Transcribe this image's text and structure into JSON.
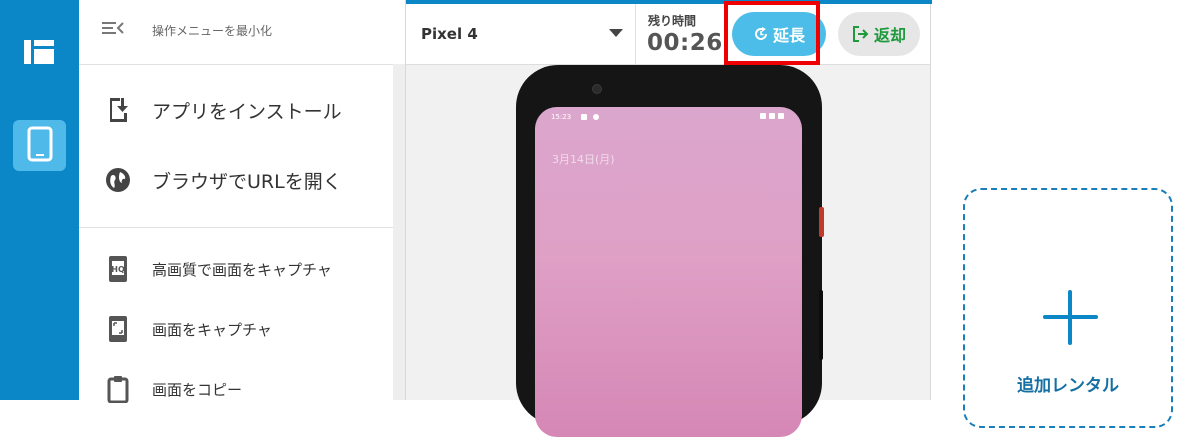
{
  "colors": {
    "rail": "#0b87c7",
    "rail_active": "#4fb9ea",
    "extend_button": "#4cbde8",
    "return_text": "#1e9a3c",
    "highlight": "#ef0000",
    "accent_blue": "#146fa3"
  },
  "rail": {
    "items": [
      {
        "icon": "panel-layout-icon",
        "active": false
      },
      {
        "icon": "smartphone-icon",
        "active": true
      }
    ]
  },
  "menu": {
    "collapse_label": "操作メニューを最小化",
    "primary_items": [
      {
        "label": "アプリをインストール",
        "icon": "install-app-icon"
      },
      {
        "label": "ブラウザでURLを開く",
        "icon": "globe-icon"
      }
    ],
    "secondary_items": [
      {
        "label": "高画質で画面をキャプチャ",
        "icon": "hq-capture-icon"
      },
      {
        "label": "画面をキャプチャ",
        "icon": "capture-icon"
      },
      {
        "label": "画面をコピー",
        "icon": "clipboard-icon"
      }
    ]
  },
  "toolbar": {
    "device_name": "Pixel 4",
    "timer_label": "残り時間",
    "timer_value": "00:26",
    "extend_label": "延長",
    "return_label": "返却"
  },
  "device_screen": {
    "status_time": "15:23",
    "lock_date": "3月14日(月)"
  },
  "add_rental": {
    "label": "追加レンタル"
  }
}
